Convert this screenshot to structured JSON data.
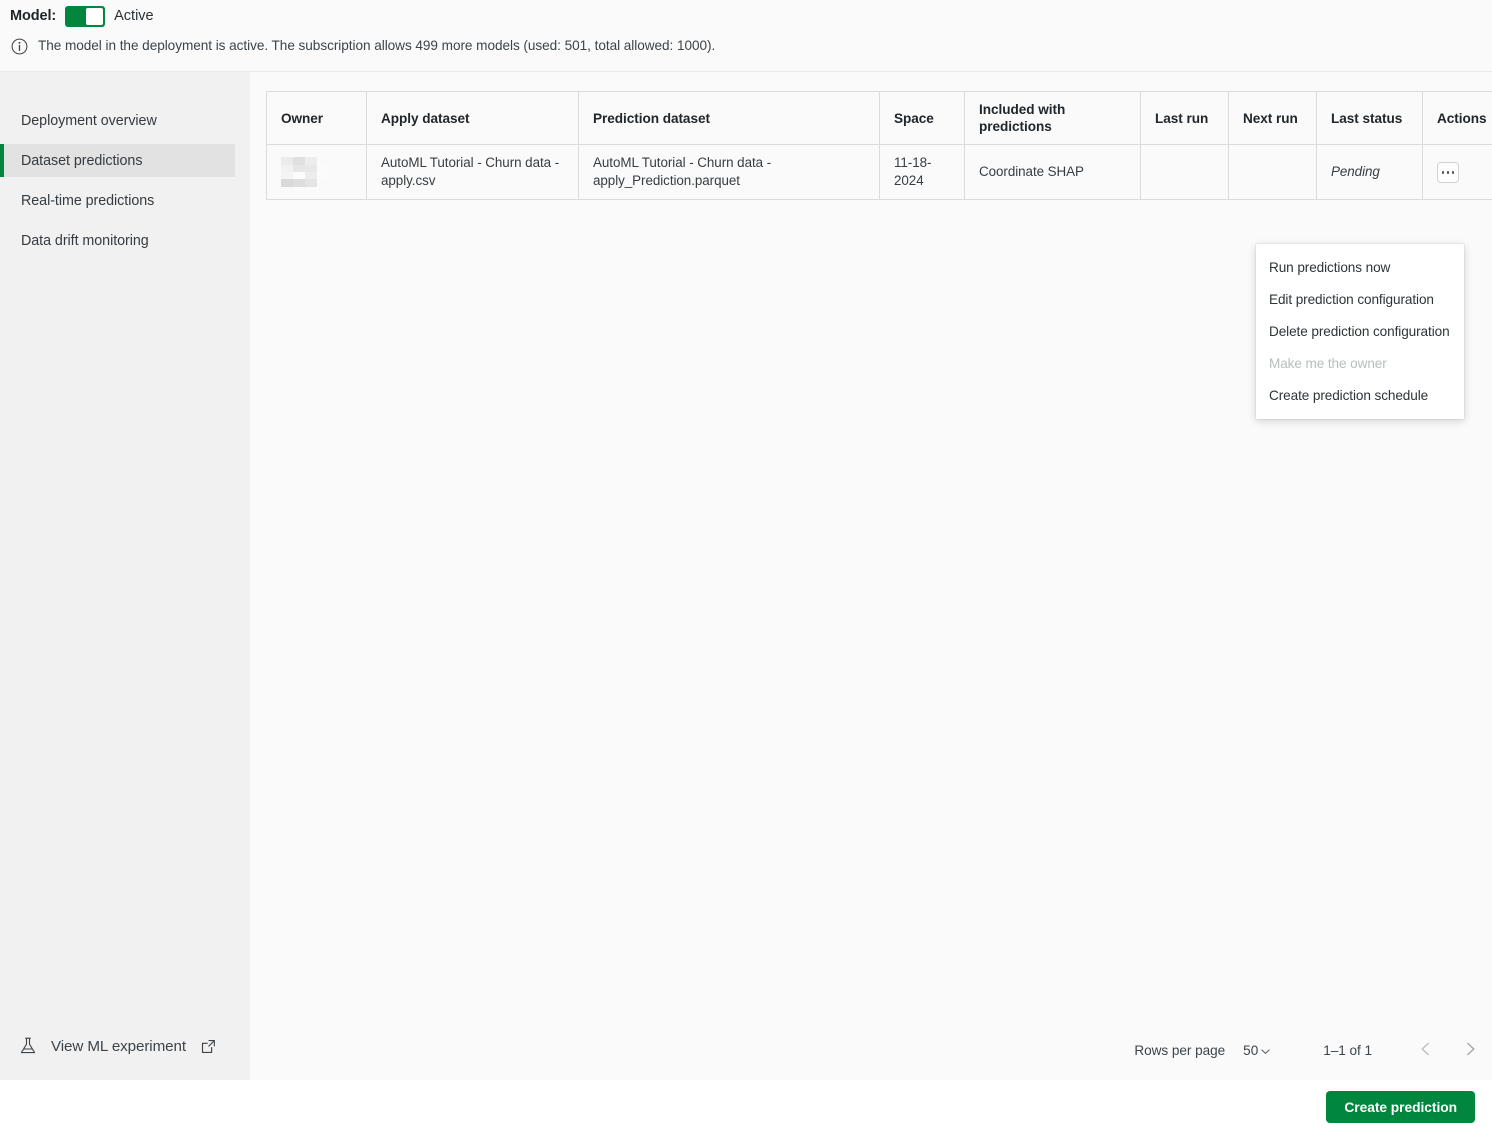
{
  "banner": {
    "model_label": "Model:",
    "toggle_state_label": "Active",
    "toggle_on": true,
    "info_icon": "info-circle-icon",
    "info_text": "The model in the deployment is active. The subscription allows 499 more models (used: 501, total allowed: 1000).",
    "subscription": {
      "more_models_allowed": 499,
      "used": 501,
      "total_allowed": 1000
    }
  },
  "sidebar": {
    "items": [
      {
        "label": "Deployment overview",
        "active": false
      },
      {
        "label": "Dataset predictions",
        "active": true
      },
      {
        "label": "Real-time predictions",
        "active": false
      },
      {
        "label": "Data drift monitoring",
        "active": false
      }
    ],
    "ml_experiment": {
      "label": "View ML experiment",
      "flask_icon": "flask-icon",
      "external_icon": "external-link-icon"
    }
  },
  "table": {
    "columns": [
      "Owner",
      "Apply dataset",
      "Prediction dataset",
      "Space",
      "Included with predictions",
      "Last run",
      "Next run",
      "Last status",
      "Actions"
    ],
    "rows": [
      {
        "owner": "",
        "owner_redacted": true,
        "apply_dataset": "AutoML Tutorial - Churn data - apply.csv",
        "prediction_dataset": "AutoML Tutorial - Churn data - apply_Prediction.parquet",
        "space": "11-18-2024",
        "included_with_predictions": "Coordinate SHAP",
        "last_run": "",
        "next_run": "",
        "last_status": "Pending",
        "actions_icon": "kebab-menu-icon"
      }
    ]
  },
  "actions_menu": {
    "open": true,
    "items": [
      {
        "label": "Run predictions now",
        "disabled": false
      },
      {
        "label": "Edit prediction configuration",
        "disabled": false
      },
      {
        "label": "Delete prediction configuration",
        "disabled": false
      },
      {
        "label": "Make me the owner",
        "disabled": true
      },
      {
        "label": "Create prediction schedule",
        "disabled": false
      }
    ]
  },
  "pagination": {
    "rows_per_page_label": "Rows per page",
    "rows_per_page_value": "50",
    "range_label": "1–1 of 1",
    "prev_icon": "chevron-left-icon",
    "next_icon": "chevron-right-icon"
  },
  "footer": {
    "create_prediction_label": "Create prediction"
  },
  "colors": {
    "accent_green": "#00873d",
    "sidebar_bg": "#f1f1f1",
    "active_nav_bg": "#e2e2e2",
    "panel_bg": "#fafafa",
    "border": "#dcdcdc",
    "text": "#21272a",
    "disabled_text": "#b9bcbe"
  }
}
